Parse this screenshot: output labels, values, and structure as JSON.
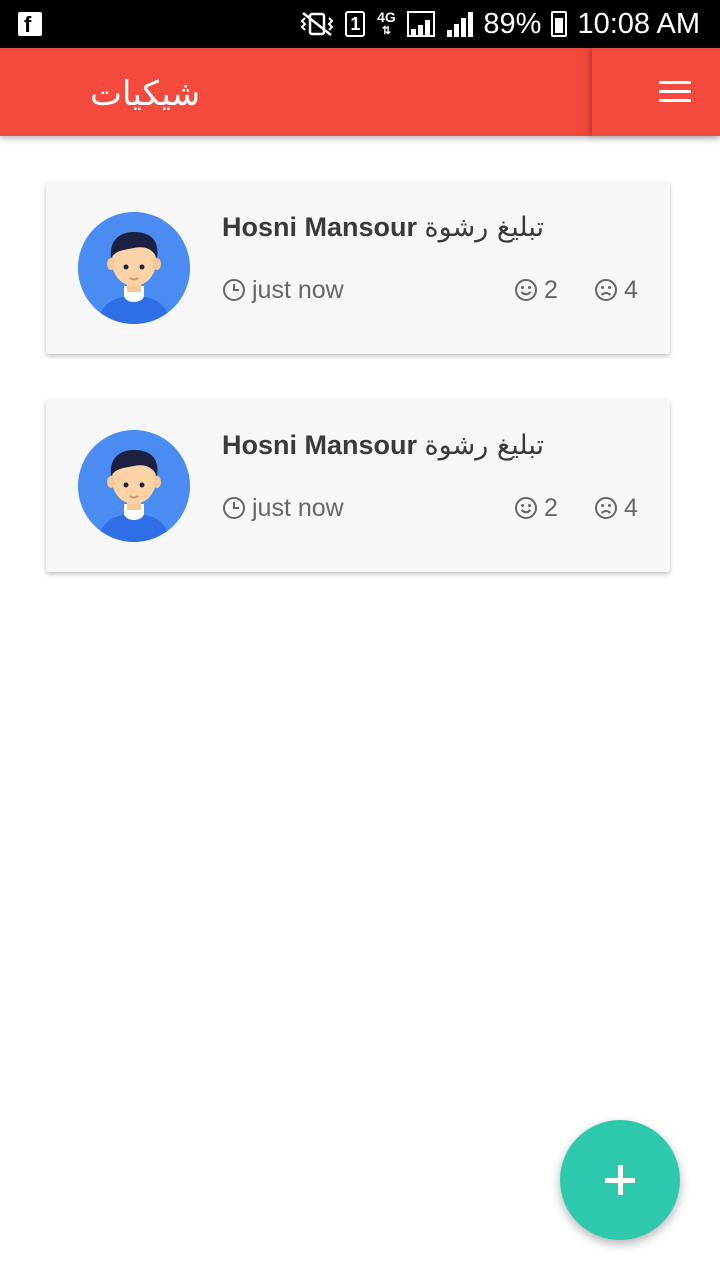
{
  "status_bar": {
    "carrier_badge": "1",
    "network": "4G",
    "battery": "89%",
    "time": "10:08 AM",
    "icons": [
      "facebook-icon",
      "vibrate-icon",
      "sim-icon",
      "data-arrows-icon",
      "signal-icon",
      "battery-charging-icon"
    ]
  },
  "app_bar": {
    "title": "شيكيات",
    "background_color": "#f44a3e",
    "menu_icon": "hamburger-menu-icon"
  },
  "cards": [
    {
      "author": "Hosni Mansour",
      "subject": "تبليغ رشوة",
      "time": "just now",
      "likes": "2",
      "dislikes": "4",
      "avatar_icon": "user-avatar-icon"
    },
    {
      "author": "Hosni Mansour",
      "subject": "تبليغ رشوة",
      "time": "just now",
      "likes": "2",
      "dislikes": "4",
      "avatar_icon": "user-avatar-icon"
    }
  ],
  "fab": {
    "icon": "plus-icon",
    "color": "#2ec9ad"
  }
}
